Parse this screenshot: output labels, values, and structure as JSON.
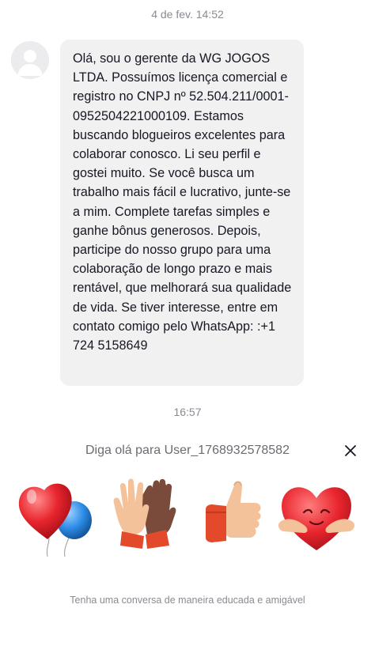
{
  "conversation": {
    "first_timestamp": "4 de fev. 14:52",
    "message_text": "Olá, sou o gerente da WG JOGOS LTDA. Possuímos licença comercial e registro no CNPJ nº 52.504.211/0001-0952504221000109. Estamos buscando blogueiros excelentes para colaborar conosco. Li seu perfil e gostei muito. Se você busca um trabalho mais fácil e lucrativo, junte-se a mim. Complete tarefas simples e ganhe bônus generosos. Depois, participe do nosso grupo para uma colaboração de longo prazo e mais rentável, que melhorará sua qualidade de vida. Se tiver interesse, entre em contato comigo pelo WhatsApp: :+1 724 5158649",
    "second_timestamp": "16:57"
  },
  "greeting_panel": {
    "prompt": "Diga olá para User_1768932578582",
    "close_icon": "close-icon",
    "stickers": [
      {
        "name": "heart-balloons-sticker"
      },
      {
        "name": "high-five-sticker"
      },
      {
        "name": "thumbs-up-sticker"
      },
      {
        "name": "hugging-heart-sticker"
      }
    ],
    "note": "Tenha uma conversa de maneira educada e amigável"
  },
  "colors": {
    "bubble_bg": "#f1f1f2",
    "heart_red": "#e8252e",
    "balloon_blue": "#2b8be6"
  }
}
